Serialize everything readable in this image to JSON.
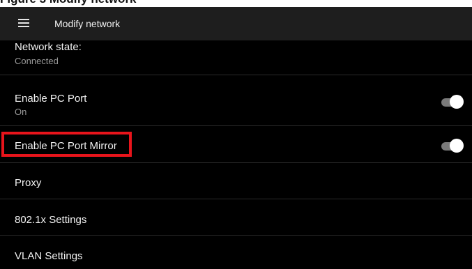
{
  "caption": {
    "text": "Figure 3  Modify network"
  },
  "appbar": {
    "title": "Modify network",
    "menu_icon": "hamburger-menu-icon"
  },
  "settings": [
    {
      "title": "Network state:",
      "subtitle": "Connected"
    },
    {
      "title": "Enable PC Port",
      "subtitle": "On",
      "toggle": "on"
    },
    {
      "title": "Enable PC Port Mirror",
      "toggle": "on"
    },
    {
      "title": "Proxy"
    },
    {
      "title": "802.1x Settings"
    },
    {
      "title": "VLAN Settings"
    }
  ],
  "colors": {
    "screen_background": "#000000",
    "appbar_background": "#1e1e1e",
    "highlight": "#e8141b",
    "toggle_track": "#7a7a7a",
    "toggle_thumb": "#ffffff"
  }
}
